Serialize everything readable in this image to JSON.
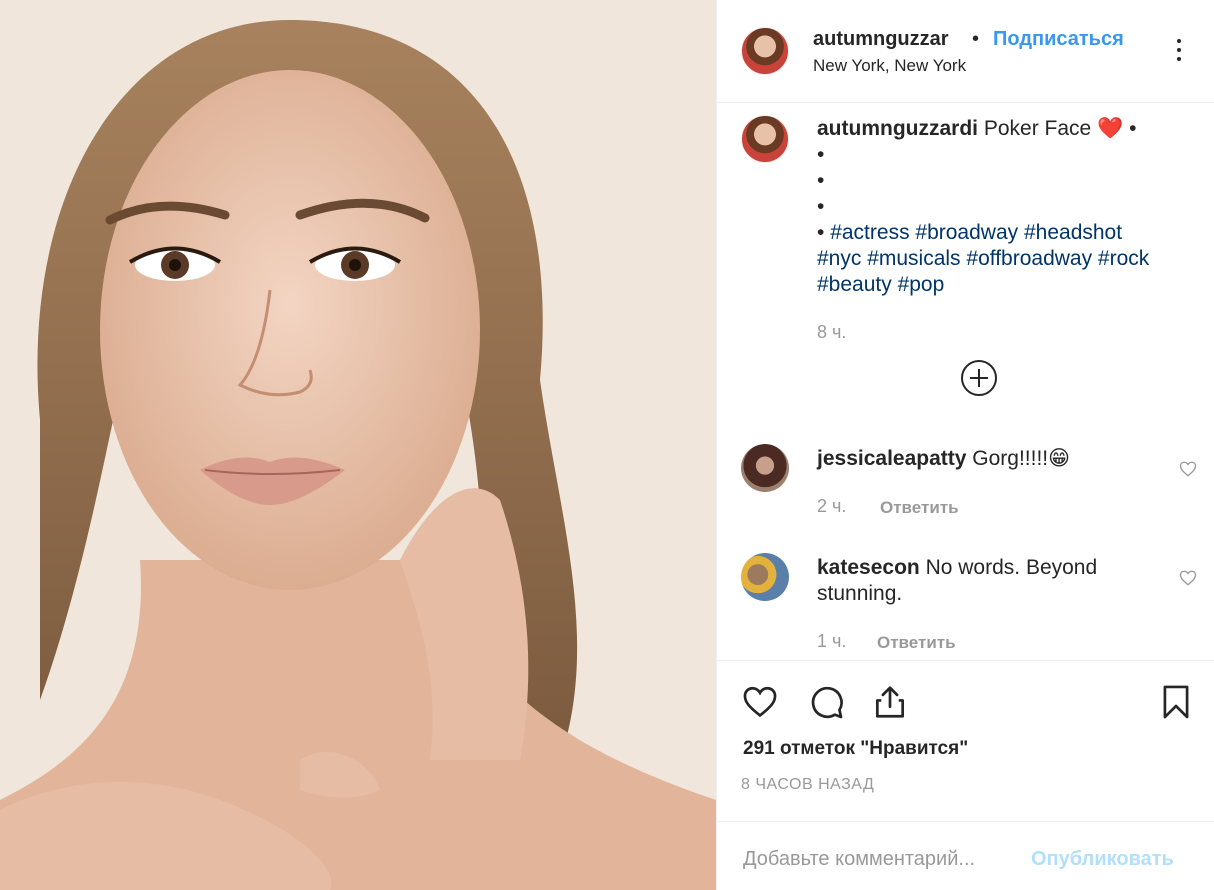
{
  "post": {
    "username": "autumnguzzar",
    "separator": "•",
    "follow_label": "Подписаться",
    "location": "New York, New York"
  },
  "caption": {
    "username": "autumnguzzardi",
    "text": "Poker Face",
    "emoji": "❤️",
    "bullet": "•",
    "hashtags_line1": "#actress #broadway #headshot",
    "hashtags_line2": "#nyc #musicals #offbroadway #rock",
    "hashtags_line3": "#beauty #pop",
    "time": "8 ч."
  },
  "comments": [
    {
      "username": "jessicaleapatty",
      "text": "Gorg!!!!!😁",
      "time": "2 ч.",
      "reply_label": "Ответить"
    },
    {
      "username": "katesecon",
      "text": "No words. Beyond stunning.",
      "time": "1 ч.",
      "reply_label": "Ответить"
    }
  ],
  "actions": {
    "likes": "291 отметок \"Нравится\"",
    "posted_ago": "8 ЧАСОВ НАЗАД",
    "comment_placeholder": "Добавьте комментарий...",
    "publish_label": "Опубликовать"
  },
  "icons": [
    "more-icon",
    "load-more-comments-icon",
    "like-icon",
    "comment-icon",
    "share-icon",
    "save-icon",
    "comment-like-icon"
  ],
  "colors": {
    "link": "#3897f0",
    "hashtag": "#003569",
    "muted": "#999999",
    "publish_disabled": "#b2dffc"
  }
}
